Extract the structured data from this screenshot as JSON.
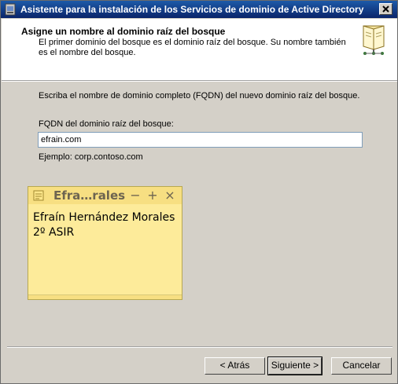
{
  "window": {
    "title": "Asistente para la instalación de los Servicios de dominio de Active Directory"
  },
  "header": {
    "title": "Asigne un nombre al dominio raíz del bosque",
    "description": "El primer dominio del bosque es el dominio raíz del bosque. Su nombre también es el nombre del bosque."
  },
  "main": {
    "prompt": "Escriba el nombre de dominio completo (FQDN) del nuevo dominio raíz del bosque.",
    "fqdn_label": "FQDN del dominio raíz del bosque:",
    "fqdn_value": "efrain.com",
    "example": "Ejemplo: corp.contoso.com"
  },
  "sticky_note": {
    "title": "Efra…rales",
    "line1": "Efraín Hernández Morales",
    "line2": "2º ASIR",
    "minimize": "−",
    "add": "+",
    "close": "×"
  },
  "buttons": {
    "back": "< Atrás",
    "next": "Siguiente >",
    "cancel": "Cancelar"
  },
  "colors": {
    "title_bar": "#0a246a",
    "note_bg": "#fdeb9a",
    "dialog_bg": "#d4d0c8"
  }
}
